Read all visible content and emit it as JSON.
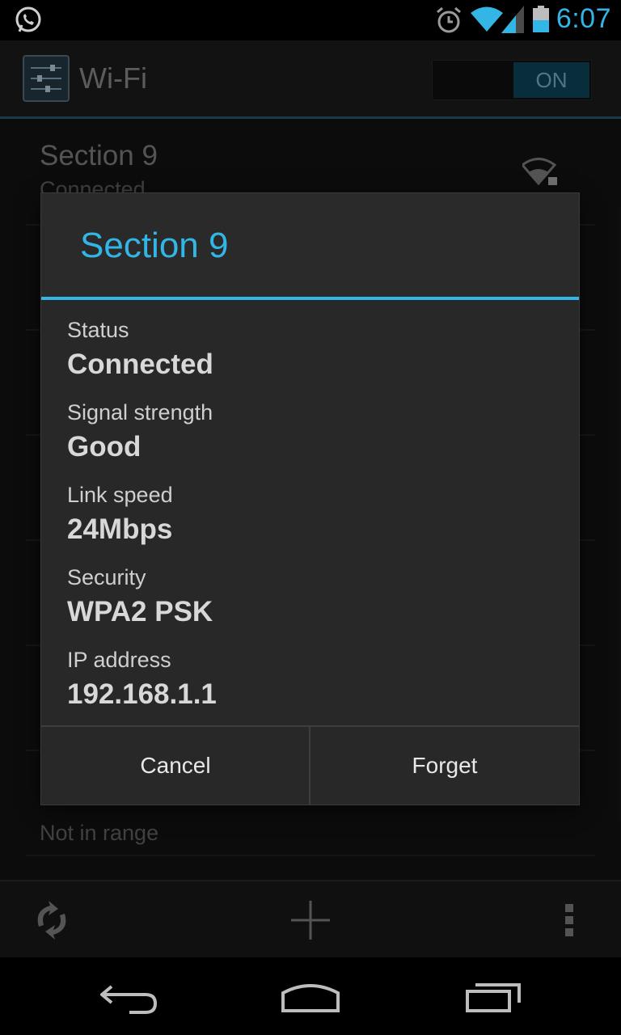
{
  "status_bar": {
    "time": "6:07",
    "icons": [
      "whatsapp-icon",
      "alarm-icon",
      "wifi-signal-icon",
      "cell-signal-icon",
      "battery-icon"
    ],
    "accent_color": "#33b5e5"
  },
  "action_bar": {
    "title": "Wi-Fi",
    "toggle_label": "ON"
  },
  "network_list": [
    {
      "name": "Section 9",
      "status": "Connected"
    },
    {
      "name": "",
      "status": ""
    },
    {
      "name": "",
      "status": ""
    },
    {
      "name": "",
      "status": ""
    },
    {
      "name": "",
      "status": ""
    },
    {
      "name": "",
      "status": ""
    },
    {
      "name": "",
      "status": "Not in range"
    }
  ],
  "dialog": {
    "title": "Section 9",
    "details": [
      {
        "label": "Status",
        "value": "Connected"
      },
      {
        "label": "Signal strength",
        "value": "Good"
      },
      {
        "label": "Link speed",
        "value": "24Mbps"
      },
      {
        "label": "Security",
        "value": "WPA2 PSK"
      },
      {
        "label": "IP address",
        "value": "192.168.1.1"
      }
    ],
    "cancel_label": "Cancel",
    "forget_label": "Forget"
  },
  "bottom_bar": {
    "icons": [
      "wps-icon",
      "add-network-icon",
      "overflow-menu-icon"
    ]
  },
  "nav_bar": {
    "icons": [
      "back-icon",
      "home-icon",
      "recent-apps-icon"
    ]
  }
}
